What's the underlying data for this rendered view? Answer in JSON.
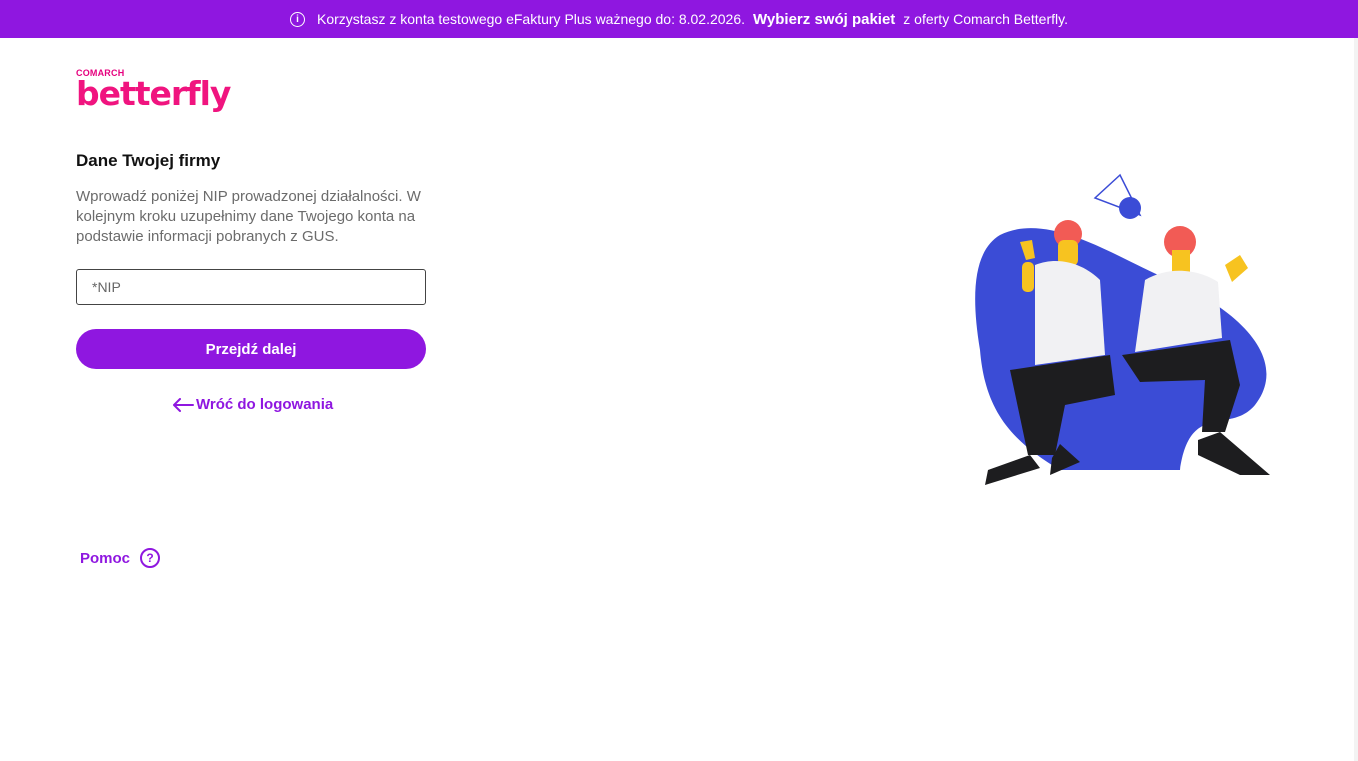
{
  "banner": {
    "text_before": "Korzystasz z konta testowego eFaktury Plus ważnego do: 8.02.2026.",
    "link_label": "Wybierz swój pakiet",
    "text_after": "z oferty Comarch Betterfly.",
    "icon": "info-icon"
  },
  "logo": {
    "brand_small": "COMARCH",
    "brand_big": "betterfly"
  },
  "form": {
    "title": "Dane Twojej firmy",
    "description": "Wprowadź poniżej NIP prowadzonej działalności. W kolejnym kroku uzupełnimy dane Twojego konta na podstawie informacji pobranych z GUS.",
    "nip_placeholder": "*NIP",
    "nip_value": "",
    "submit_label": "Przejdź dalej",
    "back_label": "Wróć do logowania",
    "back_icon": "arrow-left-icon"
  },
  "help": {
    "label": "Pomoc",
    "icon": "question-circle-icon"
  },
  "colors": {
    "accent": "#8f17e0",
    "brand": "#f0147f",
    "illustration_blue": "#3b4cd6"
  }
}
